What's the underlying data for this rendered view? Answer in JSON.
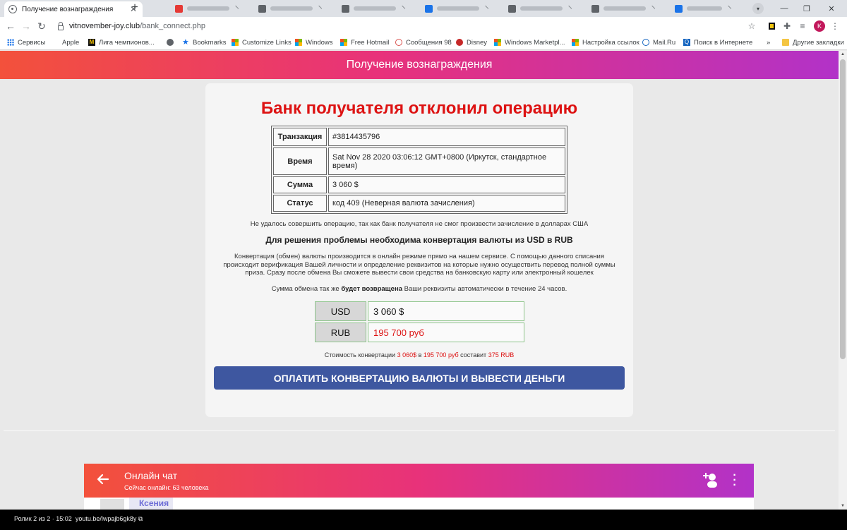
{
  "browser": {
    "active_tab_title": "Получение вознаграждения",
    "new_tab": "+",
    "url_domain": "vitnovember-joy.club",
    "url_path": "/bank_connect.php",
    "profile_initial": "K",
    "bookmarks": [
      {
        "label": "Сервисы"
      },
      {
        "label": "Apple"
      },
      {
        "label": "Лига чемпионов..."
      },
      {
        "label": ""
      },
      {
        "label": "Bookmarks"
      },
      {
        "label": "Customize Links"
      },
      {
        "label": "Windows"
      },
      {
        "label": "Free Hotmail"
      },
      {
        "label": "Сообщения 98"
      },
      {
        "label": "Disney"
      },
      {
        "label": "Windows Marketpl..."
      },
      {
        "label": "Настройка ссылок"
      },
      {
        "label": "Mail.Ru"
      },
      {
        "label": "Поиск в Интернете"
      },
      {
        "label": "Другие закладки"
      }
    ],
    "more_bookmarks": "»"
  },
  "page": {
    "header_title": "Получение вознаграждения",
    "card_title": "Банк получателя отклонил операцию",
    "table": [
      {
        "key": "Транзакция",
        "value": "#3814435796"
      },
      {
        "key": "Время",
        "value": "Sat Nov 28 2020 03:06:12 GMT+0800 (Иркутск, стандартное время)"
      },
      {
        "key": "Сумма",
        "value": "3 060 $"
      },
      {
        "key": "Статус",
        "value": "код 409 (Неверная валюта зачисления)"
      }
    ],
    "msg_failed": "Не удалось совершить операцию, так как банк получателя не смог произвести зачисление в долларах США",
    "msg_solution": "Для решения проблемы необходима конвертация валюты из USD в RUB",
    "msg_details": "Конвертация (обмен) валюты производится в онлайн режиме прямо на нашем сервисе. С помощью данного списания происходит верификация Вашей личности и определение реквизитов на которые нужно осуществить перевод полной суммы приза. Сразу после обмена Вы сможете вывести свои средства на банковскую карту или электронный кошелек",
    "msg_refund_pre": "Сумма обмена так же ",
    "msg_refund_bold": "будет возвращена",
    "msg_refund_post": " Ваши реквизиты автоматически в течение 24 часов.",
    "usd_code": "USD",
    "usd_value": "3 060 $",
    "rub_code": "RUB",
    "rub_value": "195 700 руб",
    "cost_pre": "Стоимость конвертации ",
    "cost_usd": "3 060$",
    "cost_in": " в ",
    "cost_rub": "195 700 руб",
    "cost_mid": " составит ",
    "cost_fee": "375 RUB",
    "pay_button": "ОПЛАТИТЬ КОНВЕРТАЦИЮ ВАЛЮТЫ И ВЫВЕСТИ ДЕНЬГИ"
  },
  "chat": {
    "title": "Онлайн чат",
    "subtitle": "Сейчас онлайн: 63 человека",
    "first_name": "Ксения"
  },
  "video_overlay": {
    "counter": "Ролик 2 из 2 · 15:02",
    "link": "youtu.be/lwpajb6gk8y"
  },
  "colors": {
    "accent_red": "#dd1212",
    "button_blue": "#3e57a0",
    "gradient_start": "#f3513b",
    "gradient_mid": "#e8327a",
    "gradient_end": "#b232c8"
  }
}
